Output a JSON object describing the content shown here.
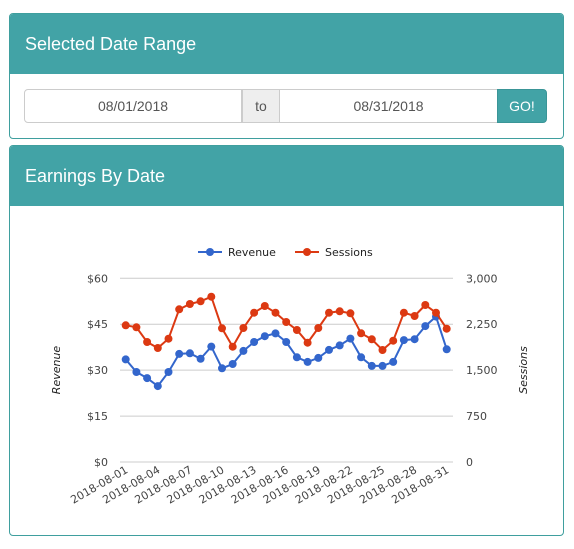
{
  "date_range_panel": {
    "title": "Selected Date Range",
    "start_date": "08/01/2018",
    "separator": "to",
    "end_date": "08/31/2018",
    "go_label": "GO!"
  },
  "earnings_panel": {
    "title": "Earnings By Date"
  },
  "colors": {
    "header": "#42a3a6",
    "revenue": "#3366cc",
    "sessions": "#dc3912"
  },
  "chart_data": {
    "type": "line",
    "title": "",
    "legend": [
      "Revenue",
      "Sessions"
    ],
    "legend_position": "top",
    "x": [
      "2018-08-01",
      "2018-08-02",
      "2018-08-03",
      "2018-08-04",
      "2018-08-05",
      "2018-08-06",
      "2018-08-07",
      "2018-08-08",
      "2018-08-09",
      "2018-08-10",
      "2018-08-11",
      "2018-08-12",
      "2018-08-13",
      "2018-08-14",
      "2018-08-15",
      "2018-08-16",
      "2018-08-17",
      "2018-08-18",
      "2018-08-19",
      "2018-08-20",
      "2018-08-21",
      "2018-08-22",
      "2018-08-23",
      "2018-08-24",
      "2018-08-25",
      "2018-08-26",
      "2018-08-27",
      "2018-08-28",
      "2018-08-29",
      "2018-08-30",
      "2018-08-31"
    ],
    "x_tick_labels": [
      "2018-08-01",
      "2018-08-04",
      "2018-08-07",
      "2018-08-10",
      "2018-08-13",
      "2018-08-16",
      "2018-08-19",
      "2018-08-22",
      "2018-08-25",
      "2018-08-28",
      "2018-08-31"
    ],
    "series": [
      {
        "name": "Revenue",
        "axis": "left",
        "values": [
          33.5,
          29.4,
          27.4,
          24.8,
          29.4,
          35.3,
          35.5,
          33.7,
          37.7,
          30.6,
          32.0,
          36.3,
          39.2,
          41.1,
          42.0,
          39.2,
          34.2,
          32.7,
          34.0,
          36.6,
          38.1,
          40.3,
          34.2,
          31.4,
          31.4,
          32.7,
          39.8,
          40.1,
          44.4,
          47.5,
          36.8
        ]
      },
      {
        "name": "Sessions",
        "axis": "right",
        "values": [
          2232,
          2200,
          1960,
          1862,
          2013,
          2493,
          2580,
          2624,
          2699,
          2183,
          1883,
          2188,
          2438,
          2547,
          2438,
          2286,
          2156,
          1948,
          2188,
          2438,
          2461,
          2428,
          2102,
          2004,
          1829,
          1981,
          2438,
          2384,
          2564,
          2438,
          2177
        ]
      }
    ],
    "ylabel_left": "Revenue",
    "ylabel_right": "Sessions",
    "ylim_left": [
      0,
      60
    ],
    "ylim_right": [
      0,
      3000
    ],
    "y_ticks_left": [
      "$0",
      "$15",
      "$30",
      "$45",
      "$60"
    ],
    "y_ticks_right": [
      "0",
      "750",
      "1,500",
      "2,250",
      "3,000"
    ],
    "grid": true
  }
}
